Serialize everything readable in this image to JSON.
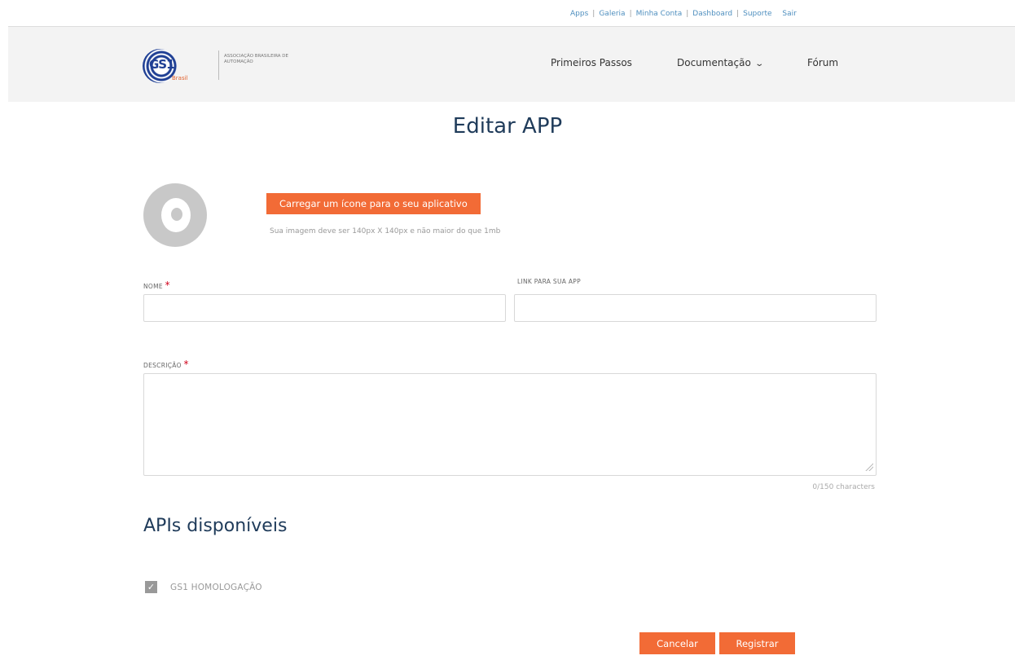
{
  "top_links": [
    "Apps",
    "Galeria",
    "Minha Conta",
    "Dashboard",
    "Suporte",
    "Sair"
  ],
  "logo": {
    "mark": "GS1",
    "country": "Brasil",
    "association": "ASSOCIAÇÃO BRASILEIRA DE AUTOMAÇÃO"
  },
  "nav": {
    "primeiros": "Primeiros Passos",
    "documentacao": "Documentação",
    "forum": "Fórum"
  },
  "page_title": "Editar APP",
  "upload": {
    "button": "Carregar um ícone para o seu aplicativo",
    "hint": "Sua imagem deve ser 140px X 140px e não maior do que 1mb"
  },
  "form": {
    "nome_label": "NOME",
    "nome_value": "",
    "link_label": "LINK PARA SUA APP",
    "link_value": "",
    "descricao_label": "DESCRIÇÃO",
    "descricao_value": "",
    "required_mark": "*",
    "char_count": "0/150 characters"
  },
  "apis": {
    "heading": "APIs disponíveis",
    "items": [
      {
        "label": "GS1 HOMOLOGAÇÃO",
        "checked": true
      }
    ]
  },
  "actions": {
    "cancel": "Cancelar",
    "register": "Registrar"
  },
  "colors": {
    "accent": "#f26b36",
    "heading": "#1f3b5a",
    "link": "#4f8fbf"
  },
  "icons": {
    "dropdown": "chevron-down-icon",
    "checkbox": "checkmark-icon",
    "app_placeholder": "app-placeholder-icon"
  }
}
